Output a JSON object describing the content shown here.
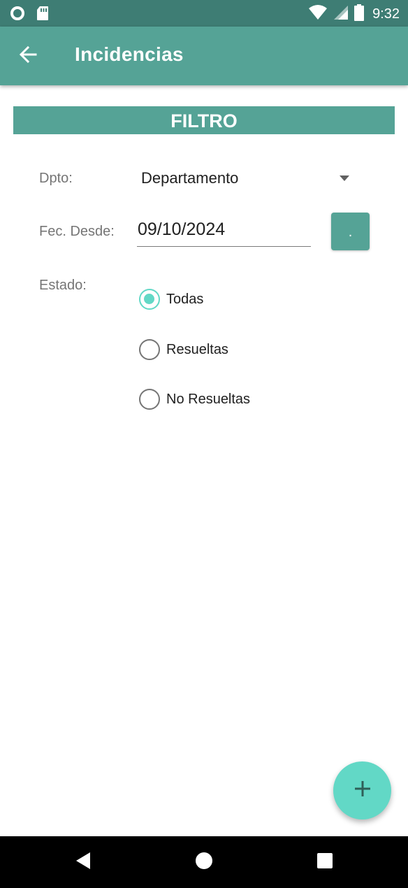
{
  "status_bar": {
    "time": "9:32",
    "icons": [
      "notification-ring-icon",
      "sd-card-icon",
      "wifi-icon",
      "cell-signal-icon",
      "battery-icon"
    ]
  },
  "app_bar": {
    "title": "Incidencias",
    "back_icon": "arrow-left-icon"
  },
  "filter": {
    "banner": "FILTRO",
    "dpto_label": "Dpto:",
    "dpto_value": "Departamento",
    "fecha_label": "Fec. Desde:",
    "fecha_value": "09/10/2024",
    "date_button_label": ".",
    "estado_label": "Estado:",
    "estado_options": [
      {
        "label": "Todas",
        "checked": true
      },
      {
        "label": "Resueltas",
        "checked": false
      },
      {
        "label": "No Resueltas",
        "checked": false
      }
    ]
  },
  "fab": {
    "icon": "plus-icon"
  },
  "nav_bar": {
    "icons": [
      "back-triangle-icon",
      "home-circle-icon",
      "recents-square-icon"
    ]
  },
  "colors": {
    "status_bar": "#3e7d74",
    "primary": "#55a396",
    "accent": "#62d8c6",
    "nav_bar": "#000000"
  }
}
